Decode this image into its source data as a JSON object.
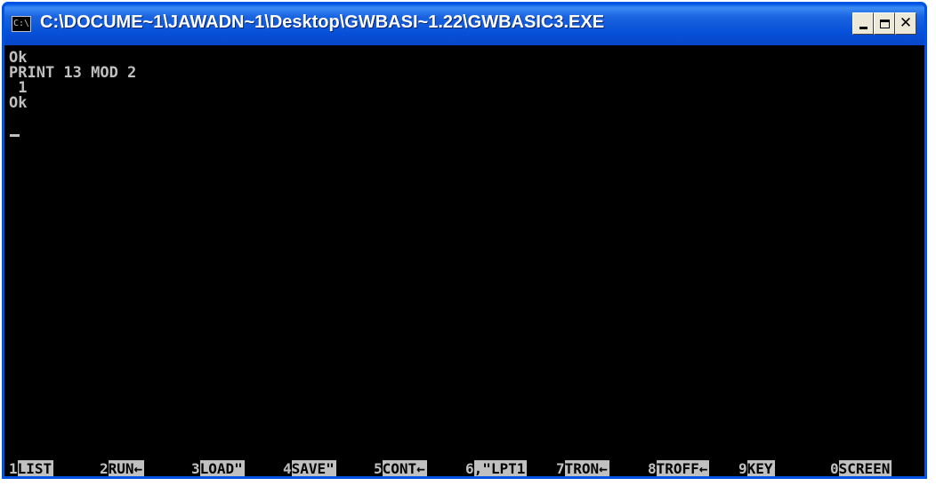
{
  "window": {
    "title": "C:\\DOCUME~1\\JAWADN~1\\Desktop\\GWBASI~1.22\\GWBASIC3.EXE",
    "icon": "console-icon",
    "icon_text": "C:\\",
    "minimize_icon": "minimize-icon",
    "maximize_icon": "maximize-icon",
    "close_icon": "close-icon",
    "close_glyph": "✕"
  },
  "console": {
    "lines": [
      "Ok",
      "PRINT 13 MOD 2",
      " 1",
      "Ok"
    ],
    "foreground": "#c0c0c0",
    "background": "#000000"
  },
  "function_keys": [
    {
      "num": "1",
      "label": "LIST"
    },
    {
      "num": "2",
      "label": "RUN←"
    },
    {
      "num": "3",
      "label": "LOAD\""
    },
    {
      "num": "4",
      "label": "SAVE\""
    },
    {
      "num": "5",
      "label": "CONT←"
    },
    {
      "num": "6",
      "label": ",\"LPT1"
    },
    {
      "num": "7",
      "label": "TRON←"
    },
    {
      "num": "8",
      "label": "TROFF←"
    },
    {
      "num": "9",
      "label": "KEY"
    },
    {
      "num": "0",
      "label": "SCREEN"
    }
  ]
}
